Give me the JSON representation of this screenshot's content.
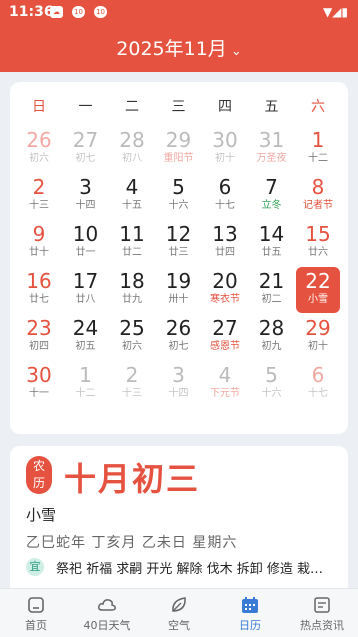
{
  "status_bar": {
    "time": "11:36",
    "icon1": "☁",
    "icon2": "10",
    "icon3": "10",
    "right": "▼◢▮"
  },
  "header": {
    "title": "2025年11月",
    "chevron": "⌄"
  },
  "weekdays": [
    "日",
    "一",
    "二",
    "三",
    "四",
    "五",
    "六"
  ],
  "calendar": [
    [
      {
        "d": "26",
        "l": "初六",
        "other": true,
        "red": true
      },
      {
        "d": "27",
        "l": "初七",
        "other": true
      },
      {
        "d": "28",
        "l": "初八",
        "other": true
      },
      {
        "d": "29",
        "l": "重阳节",
        "other": true,
        "hl": true
      },
      {
        "d": "30",
        "l": "初十",
        "other": true
      },
      {
        "d": "31",
        "l": "万圣夜",
        "other": true,
        "hl": true
      },
      {
        "d": "1",
        "l": "十二",
        "red": true
      }
    ],
    [
      {
        "d": "2",
        "l": "十三",
        "red": true
      },
      {
        "d": "3",
        "l": "十四"
      },
      {
        "d": "4",
        "l": "十五"
      },
      {
        "d": "5",
        "l": "十六"
      },
      {
        "d": "6",
        "l": "十七"
      },
      {
        "d": "7",
        "l": "立冬",
        "green": true
      },
      {
        "d": "8",
        "l": "记者节",
        "red": true,
        "hl": true
      }
    ],
    [
      {
        "d": "9",
        "l": "廿十",
        "red": true
      },
      {
        "d": "10",
        "l": "廿一"
      },
      {
        "d": "11",
        "l": "廿二"
      },
      {
        "d": "12",
        "l": "廿三"
      },
      {
        "d": "13",
        "l": "廿四"
      },
      {
        "d": "14",
        "l": "廿五"
      },
      {
        "d": "15",
        "l": "廿六",
        "red": true
      }
    ],
    [
      {
        "d": "16",
        "l": "廿七",
        "red": true
      },
      {
        "d": "17",
        "l": "廿八"
      },
      {
        "d": "18",
        "l": "廿九"
      },
      {
        "d": "19",
        "l": "卅十"
      },
      {
        "d": "20",
        "l": "寒衣节",
        "hl": true
      },
      {
        "d": "21",
        "l": "初二"
      },
      {
        "d": "22",
        "l": "小雪",
        "red": true,
        "sel": true
      }
    ],
    [
      {
        "d": "23",
        "l": "初四",
        "red": true
      },
      {
        "d": "24",
        "l": "初五"
      },
      {
        "d": "25",
        "l": "初六"
      },
      {
        "d": "26",
        "l": "初七"
      },
      {
        "d": "27",
        "l": "感恩节",
        "hl": true
      },
      {
        "d": "28",
        "l": "初九"
      },
      {
        "d": "29",
        "l": "初十",
        "red": true
      }
    ],
    [
      {
        "d": "30",
        "l": "十一",
        "red": true
      },
      {
        "d": "1",
        "l": "十二",
        "other": true
      },
      {
        "d": "2",
        "l": "十三",
        "other": true
      },
      {
        "d": "3",
        "l": "十四",
        "other": true
      },
      {
        "d": "4",
        "l": "下元节",
        "other": true,
        "hl": true
      },
      {
        "d": "5",
        "l": "十六",
        "other": true
      },
      {
        "d": "6",
        "l": "十七",
        "other": true,
        "red": true
      }
    ]
  ],
  "info": {
    "badge": "农历",
    "lunar_date": "十月初三",
    "solar_term": "小雪",
    "ganzhi": "乙巳蛇年 丁亥月 乙未日 星期六",
    "yi_label": "宜",
    "yi_items": "祭祀 祈福 求嗣 开光 解除 伐木 拆卸 修造 栽…"
  },
  "tabs": [
    {
      "label": "首页",
      "icon": "home-icon"
    },
    {
      "label": "40日天气",
      "icon": "cloud-icon"
    },
    {
      "label": "空气",
      "icon": "leaf-icon"
    },
    {
      "label": "日历",
      "icon": "calendar-icon",
      "active": true
    },
    {
      "label": "热点资讯",
      "icon": "news-icon"
    }
  ],
  "colors": {
    "accent": "#e5523f",
    "active_tab": "#3a7bd5",
    "term_green": "#2f9f52"
  }
}
